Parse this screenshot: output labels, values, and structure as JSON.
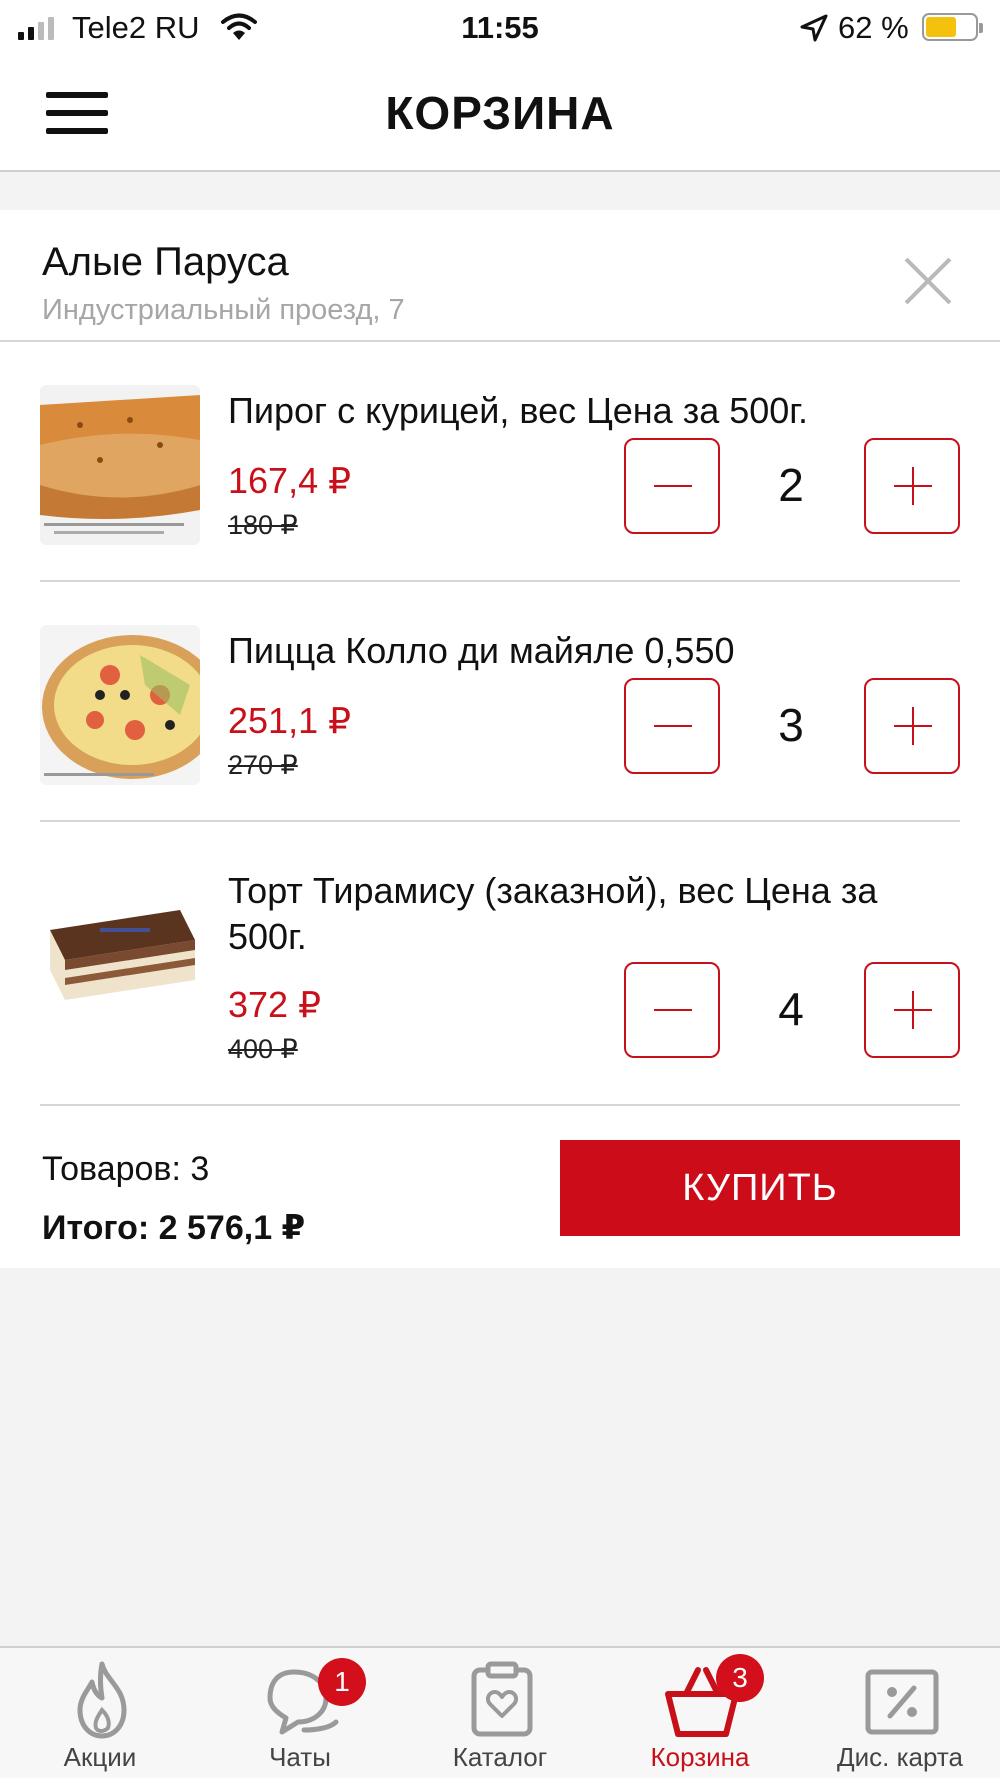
{
  "status_bar": {
    "carrier": "Tele2 RU",
    "time": "11:55",
    "battery": "62 %",
    "battery_level": 0.62,
    "icons": [
      "signal-icon",
      "wifi-icon",
      "location-arrow-icon",
      "battery-icon"
    ]
  },
  "header": {
    "title": "КОРЗИНА",
    "menu_icon": "hamburger-menu-icon"
  },
  "store": {
    "name": "Алые Паруса",
    "address": "Индустриальный проезд, 7",
    "close_icon": "close-icon"
  },
  "items": [
    {
      "name": "Пирог с курицей, вес Цена за 500г.",
      "price": "167,4 ₽",
      "old_price": "180 ₽",
      "quantity": "2",
      "image": "chicken-pie-photo"
    },
    {
      "name": "Пицца Колло ди майяле 0,550",
      "price": "251,1 ₽",
      "old_price": "270 ₽",
      "quantity": "3",
      "image": "pizza-photo"
    },
    {
      "name": "Торт Тирамису (заказной), вес Цена за 500г.",
      "price": "372 ₽",
      "old_price": "400 ₽",
      "quantity": "4",
      "image": "tiramisu-cake-photo"
    }
  ],
  "summary": {
    "count_label": "Товаров: 3",
    "total_label": "Итого: 2 576,1 ₽",
    "buy_label": "КУПИТЬ"
  },
  "tabs": [
    {
      "label": "Акции",
      "icon": "fire-icon",
      "badge": ""
    },
    {
      "label": "Чаты",
      "icon": "chat-bubbles-icon",
      "badge": "1"
    },
    {
      "label": "Каталог",
      "icon": "catalog-clipboard-icon",
      "badge": ""
    },
    {
      "label": "Корзина",
      "icon": "basket-icon",
      "badge": "3",
      "active": true
    },
    {
      "label": "Дис. карта",
      "icon": "discount-card-icon",
      "badge": ""
    }
  ],
  "colors": {
    "accent": "#c8101a",
    "buy_button": "#cc0c18",
    "battery_fill": "#f4c20d",
    "muted_text": "#a6a6a6",
    "tab_inactive": "#9a9a9a"
  }
}
